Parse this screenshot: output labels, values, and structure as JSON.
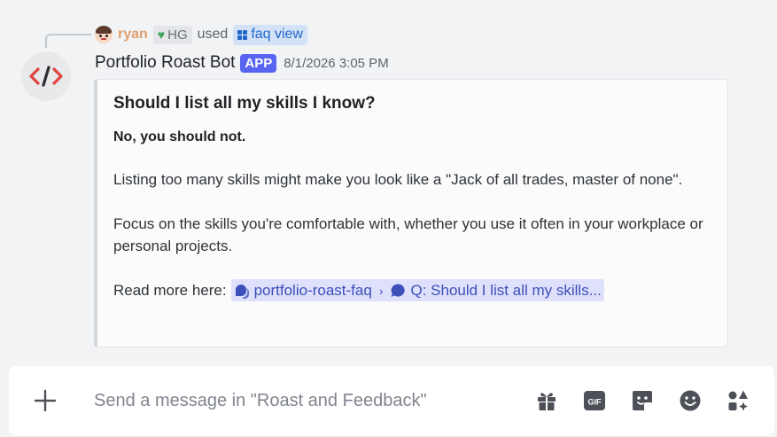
{
  "reply": {
    "username": "ryan",
    "tag": "HG",
    "used_text": "used",
    "command": "faq view"
  },
  "message": {
    "bot_name": "Portfolio Roast Bot",
    "badge": "APP",
    "timestamp": "8/1/2026 3:05 PM"
  },
  "embed": {
    "title": "Should I list all my skills I know?",
    "bold_line": "No, you should not.",
    "paragraph_1": "Listing too many skills might make you look like a \"Jack of all trades, master of none\".",
    "paragraph_2": "Focus on the skills you're comfortable with, whether you use it often in your workplace or personal projects.",
    "read_more_label": "Read more here:",
    "link_channel": "portfolio-roast-faq",
    "link_thread": "Q: Should I list all my skills..."
  },
  "composer": {
    "placeholder": "Send a message in \"Roast and Feedback\"",
    "value": "",
    "tools": [
      "gift-icon",
      "gif-icon",
      "sticker-icon",
      "emoji-icon",
      "apps-icon"
    ]
  },
  "colors": {
    "background": "#f2f3f5",
    "brand": "#5865f2",
    "reply_name": "#e0a070",
    "command_link": "#2069c9",
    "mention_bg": "#dee0fc"
  }
}
